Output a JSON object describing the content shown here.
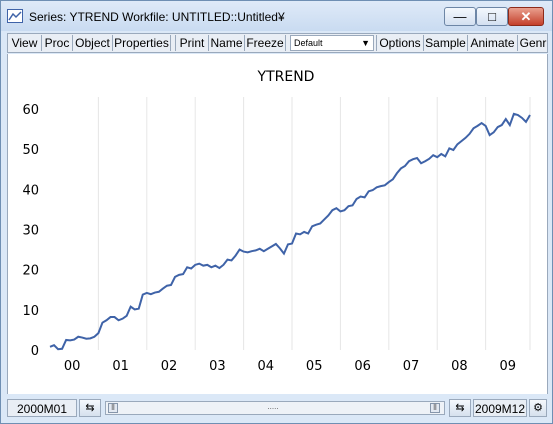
{
  "window": {
    "title": "Series: YTREND   Workfile: UNTITLED::Untitled¥",
    "minimize_glyph": "—",
    "maximize_glyph": "□",
    "close_glyph": "✕"
  },
  "toolbar": {
    "buttons": [
      "View",
      "Proc",
      "Object",
      "Properties",
      "Print",
      "Name",
      "Freeze",
      "Options",
      "Sample",
      "Animate",
      "Genr"
    ],
    "combo_value": "Default"
  },
  "chart_data": {
    "type": "line",
    "title": "YTREND",
    "xlabel": "",
    "ylabel": "",
    "ylim": [
      0,
      60
    ],
    "y_ticks": [
      0,
      10,
      20,
      30,
      40,
      50,
      60
    ],
    "x_tick_labels": [
      "00",
      "01",
      "02",
      "03",
      "04",
      "05",
      "06",
      "07",
      "08",
      "09"
    ],
    "x_start": "2000M01",
    "x_end": "2009M12",
    "grid": "vertical",
    "line_color": "#3f63a8",
    "series": [
      {
        "values": [
          0.8,
          1.2,
          0.2,
          0.3,
          2.5,
          2.4,
          2.6,
          3.3,
          3.1,
          2.8,
          2.9,
          3.3,
          4.2,
          6.8,
          7.4,
          8.2,
          8.2,
          7.4,
          7.8,
          8.5,
          10.8,
          10.1,
          10.3,
          13.8,
          14.2,
          13.9,
          14.3,
          14.5,
          15.3,
          16.0,
          16.2,
          18.2,
          18.7,
          18.9,
          20.6,
          20.3,
          21.2,
          21.5,
          21.0,
          21.2,
          20.6,
          21.0,
          20.4,
          21.2,
          22.5,
          22.3,
          23.5,
          25.0,
          24.5,
          24.3,
          24.6,
          24.8,
          25.2,
          24.6,
          25.2,
          25.8,
          26.4,
          25.3,
          24.0,
          26.3,
          26.5,
          29.0,
          28.8,
          29.4,
          29.0,
          30.8,
          31.2,
          31.5,
          32.5,
          33.5,
          34.8,
          35.3,
          34.5,
          34.8,
          35.8,
          36.0,
          37.6,
          38.2,
          38.0,
          39.5,
          39.8,
          40.5,
          40.8,
          41.0,
          41.8,
          42.5,
          44.0,
          45.2,
          45.8,
          47.0,
          47.5,
          47.8,
          46.5,
          47.0,
          47.6,
          48.5,
          48.0,
          48.8,
          48.2,
          50.2,
          49.8,
          51.2,
          52.0,
          52.8,
          53.8,
          55.2,
          55.8,
          56.5,
          55.8,
          53.5,
          54.2,
          55.5,
          56.0,
          57.5,
          56.0,
          58.8,
          58.5,
          57.8,
          56.8,
          58.5
        ]
      }
    ]
  },
  "status": {
    "start": "2000M01",
    "end": "2009M12",
    "thumb_grip": "....."
  },
  "icons": {
    "chart_icon": "line-chart-icon",
    "settings_icon": "gear-icon"
  }
}
